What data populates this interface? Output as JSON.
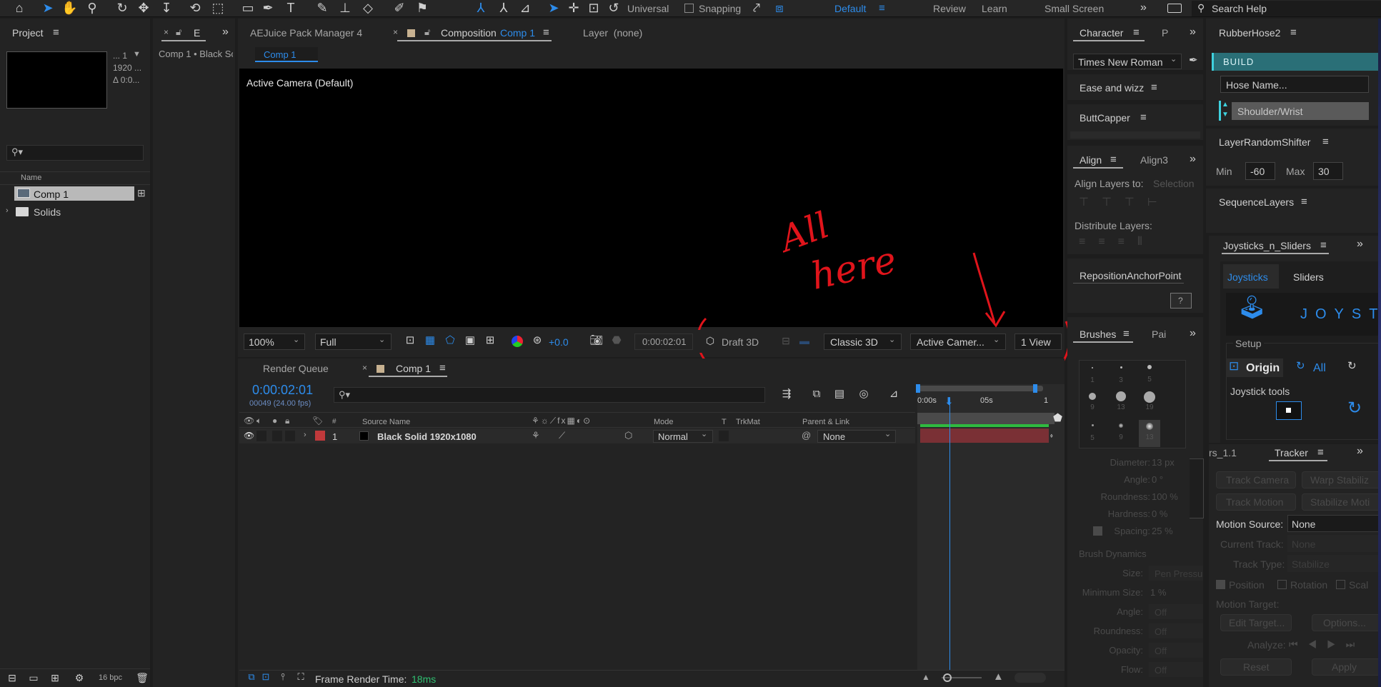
{
  "toolbar": {
    "workspace_active": "Default",
    "workspaces": [
      "Review",
      "Learn",
      "Small Screen"
    ],
    "universal_label": "Universal",
    "snapping_label": "Snapping",
    "search_placeholder": "Search Help"
  },
  "project_panel": {
    "title": "Project",
    "thumb_info": {
      "line1": "... 1",
      "line2": "1920 ...",
      "line3": "Δ 0:0..."
    },
    "column_name": "Name",
    "items": [
      {
        "name": "Comp 1",
        "type": "composition"
      },
      {
        "name": "Solids",
        "type": "folder"
      }
    ],
    "bpc": "16 bpc"
  },
  "effects_panel": {
    "tab_label": "E",
    "breadcrumb": "Comp 1 • Black Sol"
  },
  "viewer": {
    "tabs": {
      "aejuice": "AEJuice Pack Manager 4",
      "composition_prefix": "Composition",
      "composition_name": "Comp 1",
      "layer": "Layer  (none)"
    },
    "sub_tab": "Comp 1",
    "camera_label": "Active Camera (Default)",
    "zoom": "100%",
    "resolution": "Full",
    "exposure": "+0.0",
    "timecode": "0:00:02:01",
    "draft3d": "Draft 3D",
    "renderer": "Classic 3D",
    "view_camera": "Active Camer...",
    "views": "1 View",
    "annotation_words": [
      "All",
      "here"
    ]
  },
  "timeline": {
    "tabs": {
      "render_queue": "Render Queue",
      "comp": "Comp 1"
    },
    "timecode": "0:00:02:01",
    "frames": "00049 (24.00 fps)",
    "columns": {
      "num": "#",
      "source": "Source Name",
      "mode": "Mode",
      "t": "T",
      "trkmat": "TrkMat",
      "parent": "Parent & Link"
    },
    "ruler": [
      "0:00s",
      "05s",
      "1"
    ],
    "layers": [
      {
        "num": "1",
        "name": "Black Solid 1920x1080",
        "mode": "Normal",
        "parent": "None",
        "label_color": "#c0393b"
      }
    ],
    "render_time_label": "Frame Render Time:",
    "render_time_value": "18ms"
  },
  "right_col1": {
    "character": {
      "title": "Character",
      "tab2": "P",
      "font": "Times New Roman"
    },
    "ease_title": "Ease and wizz",
    "buttcapper_title": "ButtCapper",
    "align": {
      "title": "Align",
      "tab2": "Align3",
      "align_to_label": "Align Layers to:",
      "align_to_value": "Selection",
      "distribute_label": "Distribute Layers:"
    },
    "reposition_title": "RepositionAnchorPoint",
    "reposition_help": "?",
    "brushes": {
      "title": "Brushes",
      "tab2": "Pai",
      "grid": [
        {
          "size": "1"
        },
        {
          "size": "3"
        },
        {
          "size": "5"
        },
        {
          "size": "9"
        },
        {
          "size": "13"
        },
        {
          "size": "19"
        },
        {
          "size": "5"
        },
        {
          "size": "9"
        },
        {
          "size": "13"
        }
      ],
      "props": [
        {
          "label": "Diameter:",
          "value": "13 px"
        },
        {
          "label": "Angle:",
          "value": "0 °"
        },
        {
          "label": "Roundness:",
          "value": "100 %"
        },
        {
          "label": "Hardness:",
          "value": "0 %"
        },
        {
          "label": "Spacing:",
          "value": "25 %"
        }
      ],
      "dynamics_title": "Brush Dynamics",
      "dynamics": [
        {
          "label": "Size:",
          "value": "Pen Pressu"
        },
        {
          "label": "Minimum Size:",
          "value": "1 %"
        },
        {
          "label": "Angle:",
          "value": "Off"
        },
        {
          "label": "Roundness:",
          "value": "Off"
        },
        {
          "label": "Opacity:",
          "value": "Off"
        },
        {
          "label": "Flow:",
          "value": "Off"
        }
      ]
    }
  },
  "right_col2": {
    "rubberhose": {
      "title": "RubberHose2",
      "build": "BUILD",
      "hose_name": "Hose Name...",
      "preset": "Shoulder/Wrist"
    },
    "shifter": {
      "title": "LayerRandomShifter",
      "min_label": "Min",
      "min_value": "-60",
      "max_label": "Max",
      "max_value": "30"
    },
    "sequence_title": "SequenceLayers",
    "joysticks": {
      "title": "Joysticks_n_Sliders",
      "tab_joysticks": "Joysticks",
      "tab_sliders": "Sliders",
      "banner": "JOYST",
      "setup_label": "Setup",
      "origin": "Origin",
      "all": "All",
      "tools_label": "Joystick tools"
    },
    "tracker": {
      "prev_tab": "rs_1.1",
      "title": "Tracker",
      "track_camera": "Track Camera",
      "warp": "Warp Stabiliz",
      "track_motion": "Track Motion",
      "stabilize": "Stabilize Moti",
      "motion_source_label": "Motion Source:",
      "motion_source_value": "None",
      "current_track_label": "Current Track:",
      "current_track_value": "None",
      "track_type_label": "Track Type:",
      "track_type_value": "Stabilize",
      "position": "Position",
      "rotation": "Rotation",
      "scale": "Scal",
      "motion_target_label": "Motion Target:",
      "edit_target": "Edit Target...",
      "options": "Options...",
      "analyze_label": "Analyze:",
      "reset": "Reset",
      "apply": "Apply"
    }
  },
  "colors": {
    "accent": "#2d8ceb",
    "annotation": "#e0141b",
    "build_bar": "#2a6f77",
    "layer_bar": "#7a3035"
  }
}
